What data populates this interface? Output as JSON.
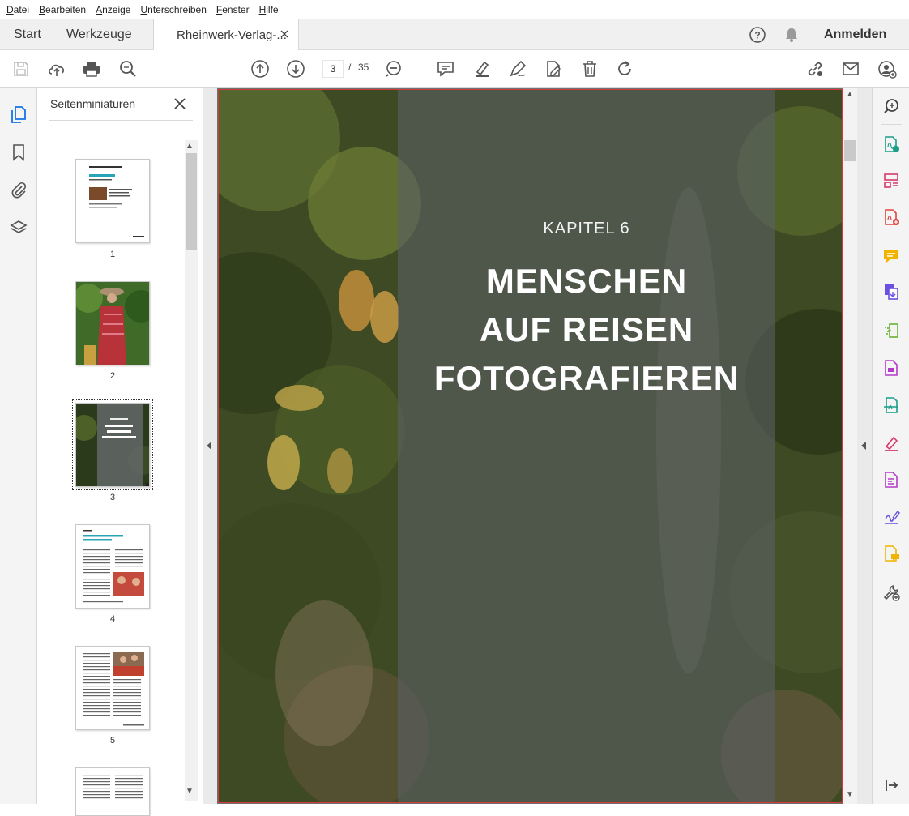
{
  "menu": [
    "Datei",
    "Bearbeiten",
    "Anzeige",
    "Unterschreiben",
    "Fenster",
    "Hilfe"
  ],
  "tabs": {
    "start": "Start",
    "tools": "Werkzeuge",
    "document": "Rheinwerk-Verlag-..."
  },
  "header": {
    "sign_in": "Anmelden"
  },
  "toolbar": {
    "current_page": "3",
    "separator": "/",
    "page_count": "35"
  },
  "thumbnails_panel": {
    "title": "Seitenminiaturen",
    "pages": [
      "1",
      "2",
      "3",
      "4",
      "5"
    ]
  },
  "document": {
    "chapter": "KAPITEL 6",
    "title_lines": [
      "MENSCHEN",
      "AUF REISEN",
      "FOTOGRAFIEREN"
    ]
  },
  "colors": {
    "accent_blue": "#1473e6",
    "selected_border": "#d23b3b"
  }
}
